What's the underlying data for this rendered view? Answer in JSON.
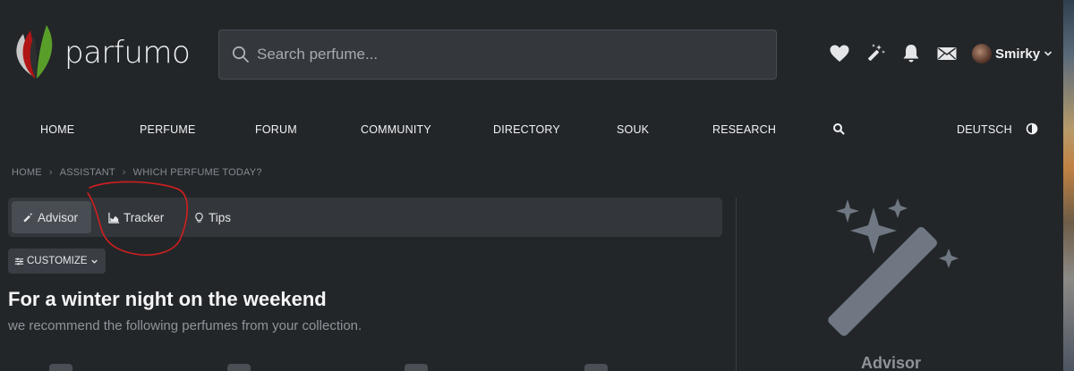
{
  "brand": {
    "name": "parfumo"
  },
  "search": {
    "placeholder": "Search perfume..."
  },
  "header_icons": [
    "heart-icon",
    "magic-wand-icon",
    "bell-icon",
    "envelope-icon"
  ],
  "user": {
    "name": "Smirky"
  },
  "nav": {
    "items": [
      "HOME",
      "PERFUME",
      "FORUM",
      "COMMUNITY",
      "DIRECTORY",
      "SOUK",
      "RESEARCH"
    ],
    "language": "DEUTSCH"
  },
  "breadcrumb": [
    "HOME",
    "ASSISTANT",
    "WHICH PERFUME TODAY?"
  ],
  "tabs": [
    {
      "label": "Advisor",
      "icon": "magic-wand-icon",
      "active": true
    },
    {
      "label": "Tracker",
      "icon": "area-chart-icon",
      "active": false
    },
    {
      "label": "Tips",
      "icon": "lightbulb-icon",
      "active": false
    }
  ],
  "customize": {
    "label": "CUSTOMIZE"
  },
  "recommendation": {
    "title": "For a winter night on the weekend",
    "subtitle": "we recommend the following perfumes from your collection."
  },
  "aside": {
    "label": "Advisor"
  },
  "colors": {
    "background": "#232629",
    "search_bg": "#34373c",
    "tab_bar_bg": "#33363b",
    "tab_active_bg": "#484c53",
    "annotation_red": "#d21f1f",
    "illustration_gray": "#6f7782"
  }
}
